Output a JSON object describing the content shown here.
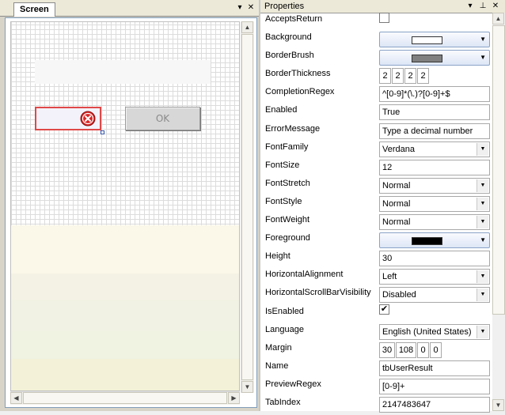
{
  "screen_pane": {
    "tab_label": "Screen",
    "dropdown_glyph": "▾",
    "close_glyph": "✕",
    "ok_button_label": "OK"
  },
  "properties_pane": {
    "title": "Properties",
    "dropdown_glyph": "▾",
    "pin_glyph": "⊥",
    "close_glyph": "✕",
    "rows": {
      "AcceptsReturn": {
        "label": "AcceptsReturn",
        "checked": false
      },
      "Background": {
        "label": "Background",
        "color": "#ffffff"
      },
      "BorderBrush": {
        "label": "BorderBrush",
        "color": "#808080"
      },
      "BorderThickness": {
        "label": "BorderThickness",
        "values": [
          "2",
          "2",
          "2",
          "2"
        ]
      },
      "CompletionRegex": {
        "label": "CompletionRegex",
        "value": "^[0-9]*(\\.)?[0-9]+$"
      },
      "Enabled": {
        "label": "Enabled",
        "value": "True"
      },
      "ErrorMessage": {
        "label": "ErrorMessage",
        "value": "Type a decimal number"
      },
      "FontFamily": {
        "label": "FontFamily",
        "value": "Verdana"
      },
      "FontSize": {
        "label": "FontSize",
        "value": "12"
      },
      "FontStretch": {
        "label": "FontStretch",
        "value": "Normal"
      },
      "FontStyle": {
        "label": "FontStyle",
        "value": "Normal"
      },
      "FontWeight": {
        "label": "FontWeight",
        "value": "Normal"
      },
      "Foreground": {
        "label": "Foreground",
        "color": "#000000"
      },
      "Height": {
        "label": "Height",
        "value": "30"
      },
      "HorizontalAlignment": {
        "label": "HorizontalAlignment",
        "value": "Left"
      },
      "HorizontalScrollBarVisibility": {
        "label": "HorizontalScrollBarVisibility",
        "value": "Disabled"
      },
      "IsEnabled": {
        "label": "IsEnabled",
        "checked": true
      },
      "Language": {
        "label": "Language",
        "value": "English (United States)"
      },
      "Margin": {
        "label": "Margin",
        "values": [
          "30",
          "108",
          "0",
          "0"
        ]
      },
      "Name": {
        "label": "Name",
        "value": "tbUserResult"
      },
      "PreviewRegex": {
        "label": "PreviewRegex",
        "value": "[0-9]+"
      },
      "TabIndex": {
        "label": "TabIndex",
        "value": "2147483647"
      }
    }
  },
  "icons": {
    "error_icon": "error-icon",
    "checkmark": "✔",
    "combo_arrow": "▼"
  },
  "colors": {
    "error_red": "#e04848",
    "selection_blue": "#3355aa",
    "panel_header": "#ece9d8"
  }
}
